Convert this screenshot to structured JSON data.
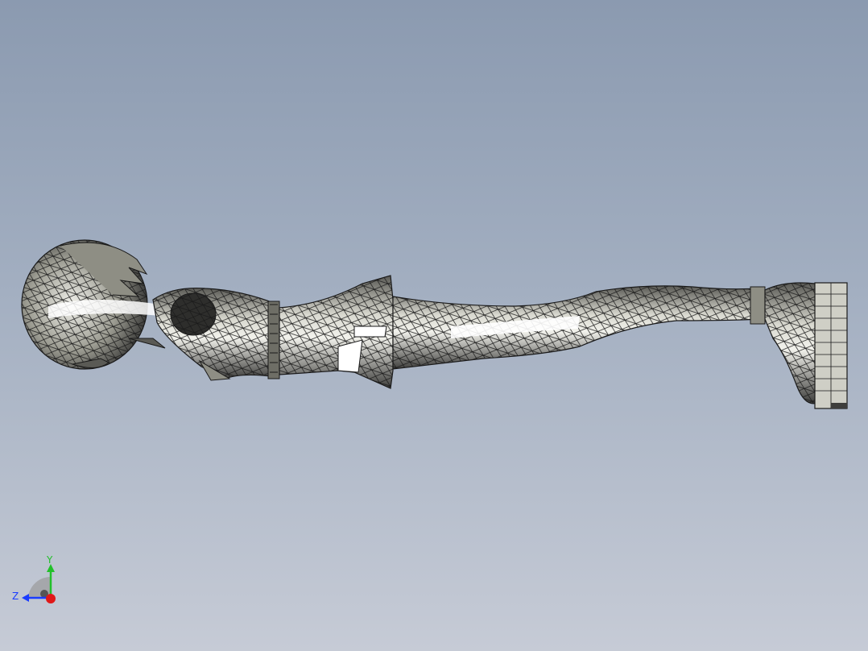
{
  "viewport": {
    "background_top": "#8b9ab0",
    "background_bottom": "#c6cbd6"
  },
  "model": {
    "shade_dark": "#3e3e3c",
    "shade_mid": "#8e8e84",
    "shade_light": "#cfcfc6",
    "highlight": "#ffffff",
    "edge": "#1a1a1a"
  },
  "triad": {
    "y_label": "Y",
    "z_label": "Z",
    "y_color": "#22c02a",
    "z_color": "#1a3cff",
    "x_color": "#e01818"
  }
}
